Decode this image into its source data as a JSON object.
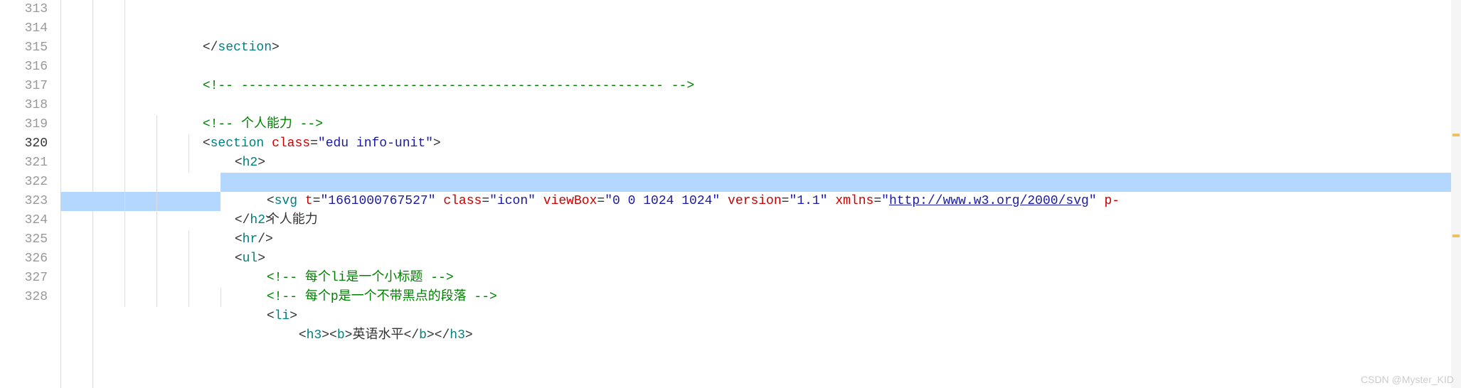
{
  "gutter": {
    "start": 313,
    "lines": [
      "313",
      "314",
      "315",
      "316",
      "317",
      "318",
      "319",
      "320",
      "321",
      "322",
      "323",
      "324",
      "325",
      "326",
      "327",
      "328"
    ],
    "activeLine": "320"
  },
  "code": {
    "l313": {
      "indent": 135,
      "pre": "</",
      "tag": "section",
      "post": ">"
    },
    "l314": {
      "indent": 135
    },
    "l315": {
      "indent": 135,
      "comment": "<!-- ------------------------------------------------------- -->"
    },
    "l316": {
      "indent": 135
    },
    "l317": {
      "indent": 135,
      "comment": "<!-- 个人能力 -->"
    },
    "l318": {
      "indent": 135,
      "pre": "<",
      "tag": "section",
      "sp": " ",
      "attr": "class",
      "eq": "=",
      "val": "\"edu info-unit\"",
      "post": ">"
    },
    "l319": {
      "indent": 180,
      "pre": "<",
      "tag": "h2",
      "post": ">"
    },
    "l320": {
      "indent": 225,
      "pre": "<",
      "tag": "svg",
      "sp": " ",
      "a1": "t",
      "eq1": "=",
      "v1": "\"1661000767527\"",
      "sp1": " ",
      "a2": "class",
      "eq2": "=",
      "v2": "\"icon\"",
      "sp2": " ",
      "a3": "viewBox",
      "eq3": "=",
      "v3": "\"0 0 1024 1024\"",
      "sp3": " ",
      "a4": "version",
      "eq4": "=",
      "v4": "\"1.1\"",
      "sp4": " ",
      "a5": "xmlns",
      "eq5": "=",
      "v5q": "\"",
      "v5url": "http://www.w3.org/2000/svg",
      "v5q2": "\"",
      "sp5": " ",
      "a6": "p-"
    },
    "l321": {
      "indent": 225,
      "text": "个人能力"
    },
    "l322": {
      "indent": 180,
      "pre": "</",
      "tag": "h2",
      "post": ">"
    },
    "l323": {
      "indent": 180,
      "pre": "<",
      "tag": "hr",
      "post": "/>"
    },
    "l324": {
      "indent": 180,
      "pre": "<",
      "tag": "ul",
      "post": ">"
    },
    "l325": {
      "indent": 225,
      "comment": "<!-- 每个li是一个小标题 -->"
    },
    "l326": {
      "indent": 225,
      "comment": "<!-- 每个p是一个不带黑点的段落 -->"
    },
    "l327": {
      "indent": 225,
      "pre": "<",
      "tag": "li",
      "post": ">"
    },
    "l328": {
      "indent": 270,
      "o1": "<",
      "t1": "h3",
      "c1": "><",
      "t2": "b",
      "c2": ">",
      "txt": "英语水平",
      "o3": "</",
      "t3": "b",
      "c3": "></",
      "t4": "h3",
      "c4": ">"
    }
  },
  "watermark": "CSDN @Myster_KID"
}
